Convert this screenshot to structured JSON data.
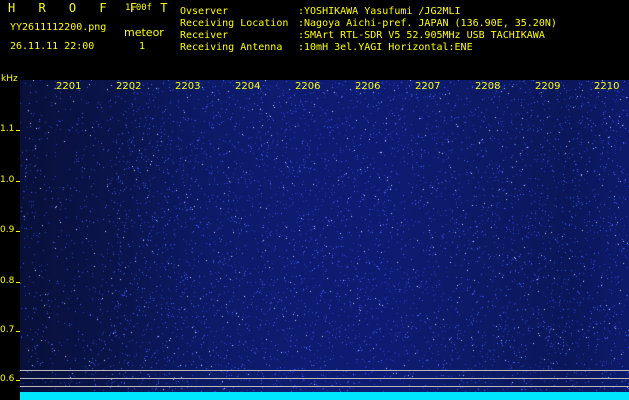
{
  "header": {
    "brand": "H R O F F T",
    "version": "1.00f",
    "filename": "YY2611112200.png",
    "mode_label": "meteor",
    "mode_value": "1",
    "datetime": "26.11.11 22:00"
  },
  "info": {
    "observer_key": "Ovserver",
    "observer_val": ":YOSHIKAWA Yasufumi /JG2MLI",
    "location_key": "Receiving Location",
    "location_val": ":Nagoya Aichi-pref. JAPAN (136.90E, 35.20N)",
    "receiver_key": "Receiver",
    "receiver_val": ":SMArt RTL-SDR V5 52.905MHz USB TACHIKAWA",
    "antenna_key": "Receiving Antenna",
    "antenna_val": ":10mH 3el.YAGI Horizontal:ENE"
  },
  "axis": {
    "y_unit": "kHz",
    "y_ticks": [
      "1.1",
      "1.0",
      "0.9",
      "0.8",
      "0.7",
      "0.6"
    ],
    "minutes": [
      "2201",
      "2202",
      "2203",
      "2204",
      "2206",
      "2206",
      "2207",
      "2208",
      "2209",
      "2210"
    ]
  },
  "colors": {
    "text": "#ffff00",
    "background": "#000000",
    "noise": "#3f5bff",
    "baseline": "#00e6ff"
  }
}
